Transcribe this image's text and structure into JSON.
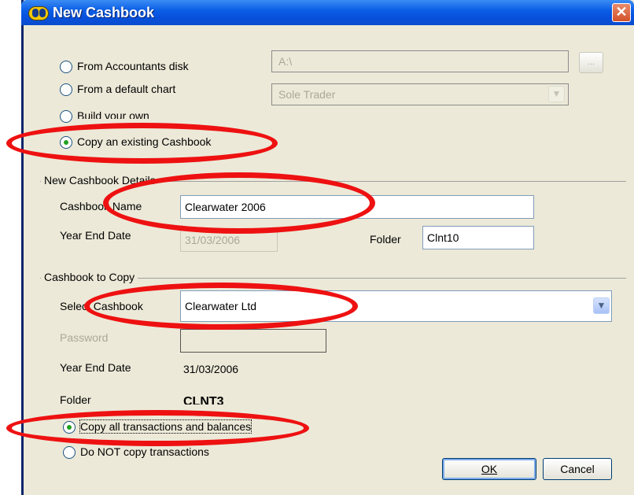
{
  "window": {
    "title": "New Cashbook",
    "close_glyph": "✕"
  },
  "source": {
    "accountants_disk_label": "From Accountants disk",
    "accountants_disk_path": "A:\\",
    "browse_label": "...",
    "default_chart_label": "From a default chart",
    "default_chart_value": "Sole Trader",
    "build_own_label": "Build your own",
    "copy_existing_label": "Copy an existing Cashbook",
    "selected": "copy_existing"
  },
  "details": {
    "group_label": "New Cashbook Details",
    "name_label": "Cashbook Name",
    "name_value": "Clearwater 2006",
    "year_end_label": "Year End Date",
    "year_end_value": "31/03/2006",
    "folder_label": "Folder",
    "folder_value": "Clnt10"
  },
  "copy": {
    "group_label": "Cashbook to Copy",
    "select_label": "Select Cashbook",
    "select_value": "Clearwater Ltd",
    "password_label": "Password",
    "password_value": "",
    "year_end_label": "Year End Date",
    "year_end_value": "31/03/2006",
    "folder_label": "Folder",
    "folder_value": "CLNT3",
    "copy_all_label": "Copy all transactions and balances",
    "no_copy_label": "Do NOT copy transactions",
    "selected": "copy_all"
  },
  "buttons": {
    "ok": "OK",
    "cancel": "Cancel"
  },
  "icons": {
    "chevron": "chevron-down-icon"
  },
  "colors": {
    "highlight_ellipse": "#ee1111",
    "titlebar": "#0b5fe6"
  }
}
